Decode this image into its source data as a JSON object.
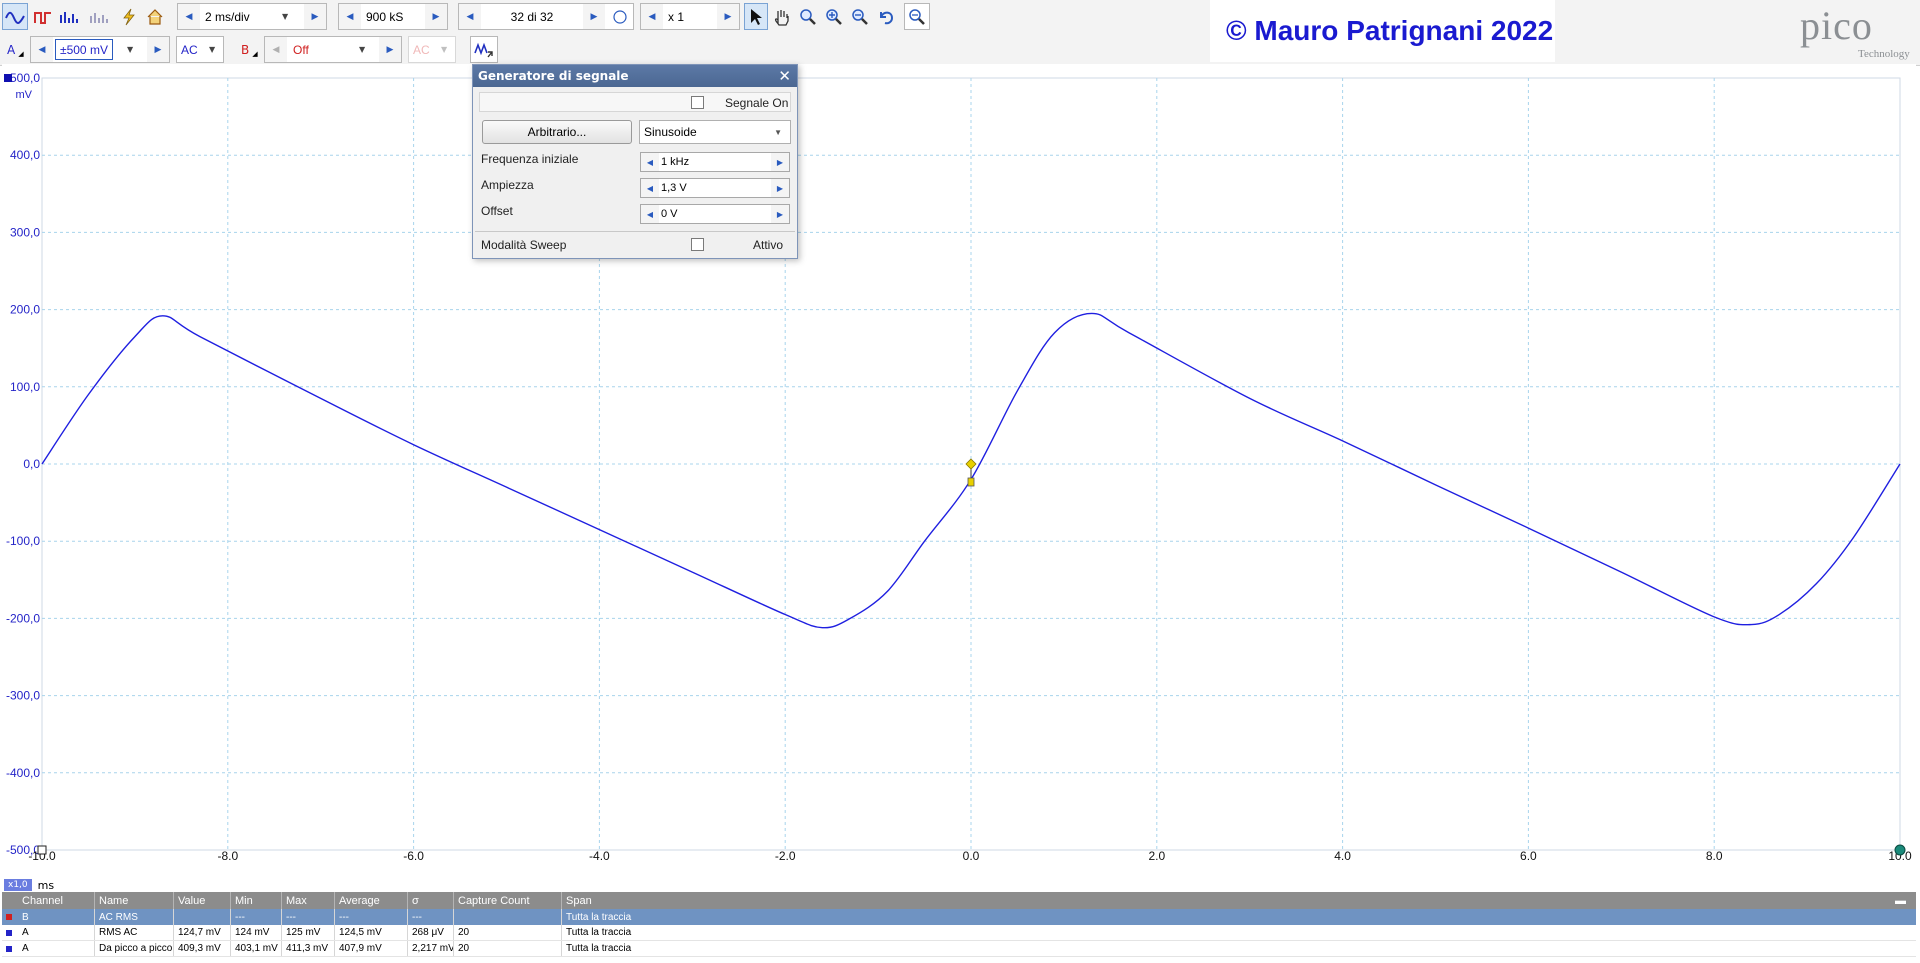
{
  "toolbar1": {
    "timebase": "2 ms/div",
    "samples": "900 kS",
    "capture": "32 di 32",
    "zoom": "x 1"
  },
  "toolbar2": {
    "channel_a": "A",
    "range_a": "±500 mV",
    "coupling_a": "AC",
    "channel_b": "B",
    "range_b": "Off",
    "coupling_b": "AC"
  },
  "watermark": "© Mauro Patrignani 2022",
  "logo": {
    "word": "pico",
    "sub": "Technology"
  },
  "plot": {
    "y_unit": "mV",
    "y_ticks": [
      "500,0",
      "400,0",
      "300,0",
      "200,0",
      "100,0",
      "0,0",
      "-100,0",
      "-200,0",
      "-300,0",
      "-400,0",
      "-500,0"
    ],
    "x_ticks": [
      "-10,0",
      "-8,0",
      "-6,0",
      "-4,0",
      "-2,0",
      "0,0",
      "2,0",
      "4,0",
      "6,0",
      "8,0",
      "10,0"
    ],
    "x_unit": "ms",
    "x_zoom": "x1,0"
  },
  "chart_data": {
    "type": "line",
    "xlabel": "ms",
    "ylabel": "mV",
    "xlim": [
      -10,
      10
    ],
    "ylim": [
      -500,
      500
    ],
    "grid": true,
    "series": [
      {
        "color": "#1f1fe0",
        "x": [
          -10.0,
          -9.5,
          -9.0,
          -8.7,
          -8.3,
          -7.0,
          -6.0,
          -5.0,
          -4.0,
          -3.0,
          -2.0,
          -1.6,
          -1.3,
          -0.9,
          -0.5,
          0.0,
          0.5,
          0.9,
          1.3,
          1.7,
          3.0,
          4.0,
          5.0,
          6.0,
          7.0,
          8.0,
          8.4,
          8.7,
          9.1,
          9.5,
          10.0
        ],
        "y": [
          0,
          90,
          165,
          192,
          165,
          85,
          25,
          -30,
          -85,
          -140,
          -195,
          -212,
          -200,
          -165,
          -100,
          -20,
          95,
          170,
          195,
          170,
          85,
          30,
          -27,
          -83,
          -140,
          -198,
          -208,
          -195,
          -155,
          -95,
          0
        ]
      }
    ],
    "trigger": {
      "x": 0.0,
      "y": 0.0,
      "color": "#e8d000"
    }
  },
  "dialog": {
    "title": "Generatore di segnale",
    "signal_on": "Segnale On",
    "arbitrary": "Arbitrario...",
    "waveform": "Sinusoide",
    "freq_label": "Frequenza iniziale",
    "freq_value": "1 kHz",
    "amp_label": "Ampiezza",
    "amp_value": "1,3 V",
    "offset_label": "Offset",
    "offset_value": "0 V",
    "sweep_label": "Modalità Sweep",
    "sweep_active": "Attivo"
  },
  "measurements": {
    "headers": [
      "Channel",
      "Name",
      "Value",
      "Min",
      "Max",
      "Average",
      "σ",
      "Capture Count",
      "Span"
    ],
    "rows": [
      [
        "B",
        "AC RMS",
        "",
        "---",
        "---",
        "---",
        "---",
        "",
        "Tutta la traccia"
      ],
      [
        "A",
        "RMS AC",
        "124,7 mV",
        "124 mV",
        "125 mV",
        "124,5 mV",
        "268 μV",
        "20",
        "Tutta la traccia"
      ],
      [
        "A",
        "Da picco a picco",
        "409,3 mV",
        "403,1 mV",
        "411,3 mV",
        "407,9 mV",
        "2,217 mV",
        "20",
        "Tutta la traccia"
      ]
    ],
    "colors": {
      "channel_a": "#2424c8",
      "channel_b": "#d02020"
    }
  }
}
